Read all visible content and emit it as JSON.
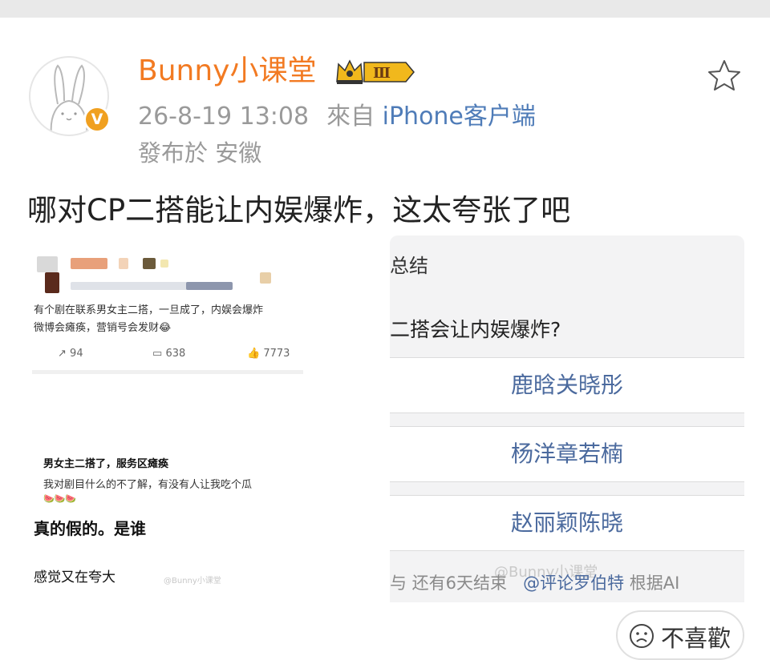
{
  "post": {
    "username": "Bunny小课堂",
    "level_badge": "Ⅲ",
    "verified_badge": "V",
    "timestamp": "26-8-19 13:08",
    "source_prefix": "來自",
    "source": "iPhone客户端",
    "location": "發布於 安徽",
    "text": "哪对CP二搭能让内娱爆炸，这太夸张了吧"
  },
  "left_screenshot": {
    "line1": "有个剧在联系男女主二搭，一旦成了，内娱会爆炸",
    "line2": "微博会瘫痪，营销号会发财😂",
    "repost_count": "94",
    "comment_count": "638",
    "like_count": "7773",
    "heading2": "男女主二搭了，服务区瘫痪",
    "line3": "我对剧目什么的不了解，有没有人让我吃个瓜",
    "emojis": "🍉🍉🍉",
    "comment1": "真的假的。是谁",
    "comment2": "感觉又在夸大",
    "watermark": "@Bunny小课堂"
  },
  "poll": {
    "header": "总结",
    "question": "二搭会让内娱爆炸?",
    "options": [
      "鹿晗关晓彤",
      "杨洋章若楠",
      "赵丽颖陈晓"
    ],
    "footer_left": "与  还有6天结束",
    "footer_link": "@评论罗伯特",
    "footer_right": "根据AI",
    "watermark": "@Bunny小课堂"
  },
  "actions": {
    "dislike_label": "不喜歡"
  },
  "colors": {
    "username": "#f27a22",
    "source_link": "#4f7cb8",
    "poll_option": "#4b6a9e",
    "meta_grey": "#9a9a9a",
    "verified": "#f0a020"
  },
  "icons": {
    "favorite": "star-outline-icon",
    "level": "crown-level-icon",
    "verified": "verified-v-icon",
    "dislike": "sad-face-icon"
  }
}
